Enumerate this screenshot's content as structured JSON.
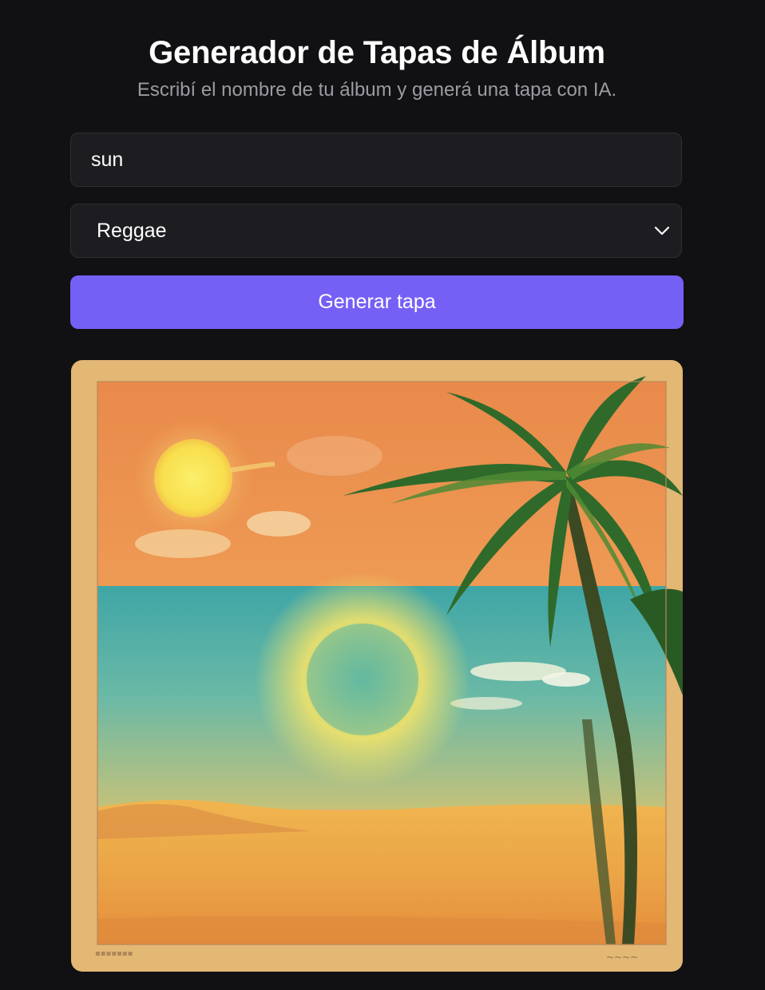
{
  "header": {
    "title": "Generador de Tapas de Álbum",
    "subtitle": "Escribí el nombre de tu álbum y generá una tapa con IA."
  },
  "form": {
    "album_name_value": "sun",
    "genre_selected": "Reggae",
    "generate_label": "Generar tapa"
  },
  "result": {
    "cover_image": "generated-album-cover-sun-beach-palm"
  },
  "colors": {
    "background": "#111113",
    "field_background": "#1c1c21",
    "accent": "#7560f5"
  }
}
